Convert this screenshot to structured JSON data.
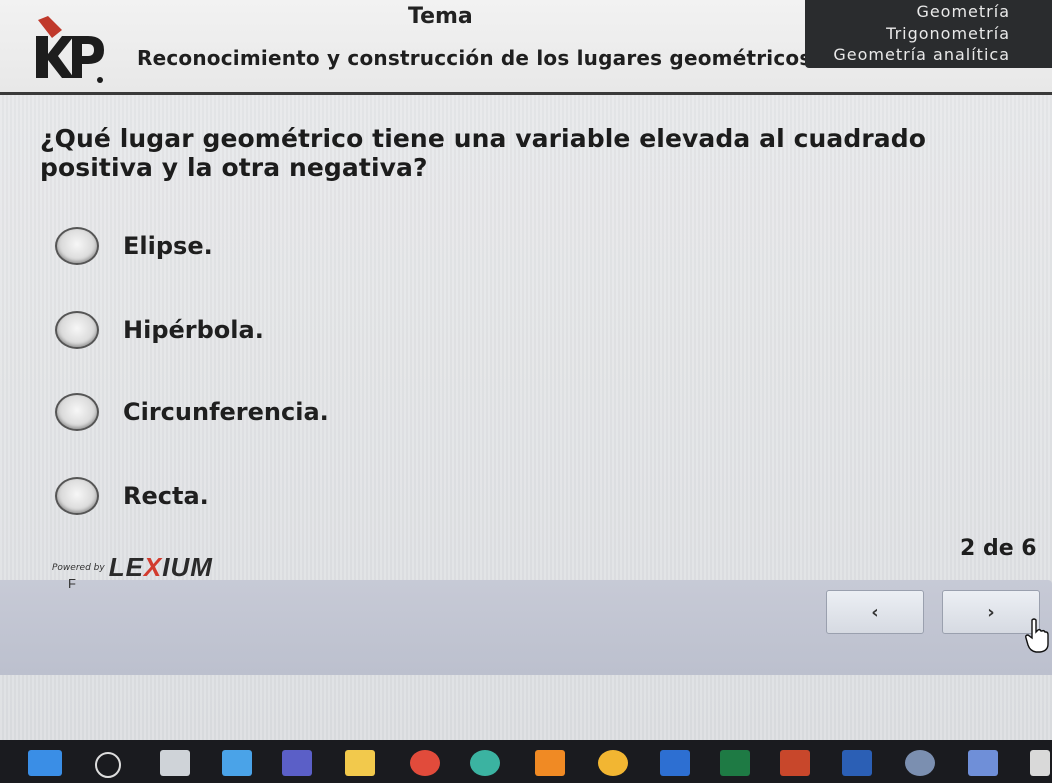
{
  "header": {
    "tema_label": "Tema",
    "subtitle": "Reconocimiento y construcción de los lugares geométricos.",
    "topics": [
      "Geometría",
      "Trigonometría",
      "Geometría analítica"
    ]
  },
  "question": {
    "text": "¿Qué lugar geométrico tiene una variable elevada al cuadrado positiva y la otra negativa?",
    "options": [
      "Elipse.",
      "Hipérbola.",
      "Circunferencia.",
      "Recta."
    ]
  },
  "footer": {
    "powered_by": "Powered by",
    "brand_part1": "LE",
    "brand_x": "X",
    "brand_part2": "IUM",
    "sub_letter": "F",
    "counter": "2 de 6",
    "prev_label": "‹",
    "next_label": "›"
  },
  "taskbar": {
    "icons": [
      "start-icon",
      "search-icon",
      "task-view-icon",
      "widgets-icon",
      "teams-icon",
      "file-explorer-icon",
      "chrome-icon",
      "edge-icon",
      "vlc-icon",
      "chrome-canary-icon",
      "store-icon",
      "excel-icon",
      "powerpoint-icon",
      "word-icon",
      "r-icon",
      "r-console-icon",
      "app-icon"
    ]
  },
  "colors": {
    "header_topics_bg": "#2a2c2e",
    "navbar_bg": "#c2c6d3",
    "brand_accent": "#d23b2e"
  }
}
